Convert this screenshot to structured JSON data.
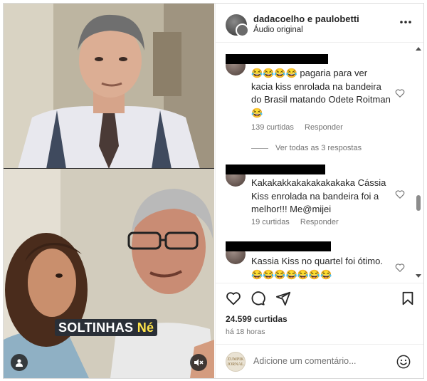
{
  "post": {
    "author": "dadacoelho e paulobetti",
    "audio": "Áudio original",
    "likes": "24.599 curtidas",
    "time_ago": "há 18 horas"
  },
  "video": {
    "caption_part1": "SOLTINHAS",
    "caption_part2": "Né"
  },
  "comments": [
    {
      "text": "😂😂😂😂 pagaria para ver kacia kiss enrolada na bandeira do Brasil matando Odete Roitman 😂",
      "likes": "139 curtidas",
      "reply": "Responder",
      "view_replies": "Ver todas as 3 respostas"
    },
    {
      "text": "Kakakakkakakakakakaka Cássia Kiss enrolada na bandeira foi a melhor!!! Me@mijei",
      "likes": "19 curtidas",
      "reply": "Responder"
    },
    {
      "text": "Kassia Kiss no quartel foi ótimo. 😂😂😂😂😂😂😂"
    }
  ],
  "add_comment": {
    "placeholder": "Adicione um comentário...",
    "avatar_text": "ZUMPIK JORNAL"
  },
  "icons": {
    "more": "more-options-icon",
    "heart": "heart-icon",
    "comment": "comment-icon",
    "share": "share-icon",
    "save": "bookmark-icon",
    "emoji": "emoji-icon",
    "mute": "muted-speaker-icon",
    "user": "user-tag-icon"
  },
  "colors": {
    "caption_bg": "#2a2f37",
    "caption_highlight": "#ffe44a",
    "text": "#262626",
    "muted_text": "#737373"
  }
}
